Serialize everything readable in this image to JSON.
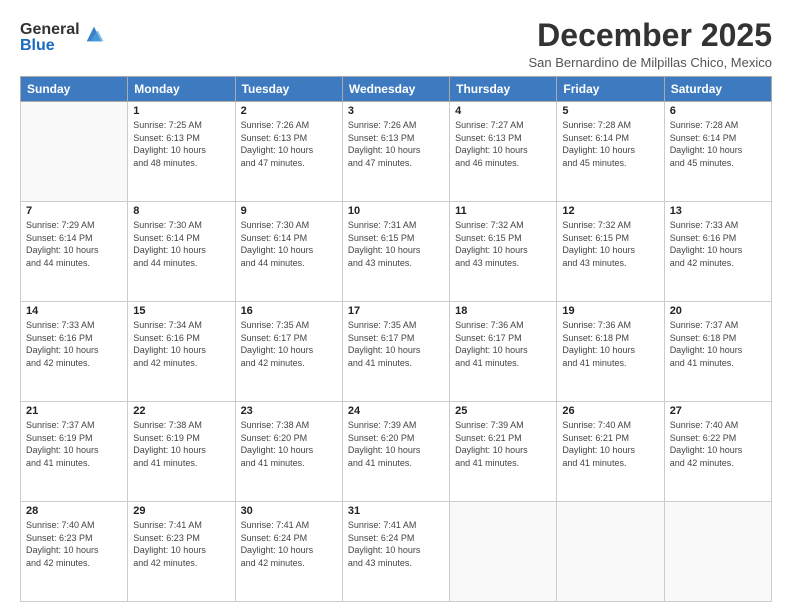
{
  "logo": {
    "general": "General",
    "blue": "Blue"
  },
  "title": "December 2025",
  "subtitle": "San Bernardino de Milpillas Chico, Mexico",
  "days_of_week": [
    "Sunday",
    "Monday",
    "Tuesday",
    "Wednesday",
    "Thursday",
    "Friday",
    "Saturday"
  ],
  "weeks": [
    [
      {
        "day": "",
        "info": ""
      },
      {
        "day": "1",
        "info": "Sunrise: 7:25 AM\nSunset: 6:13 PM\nDaylight: 10 hours\nand 48 minutes."
      },
      {
        "day": "2",
        "info": "Sunrise: 7:26 AM\nSunset: 6:13 PM\nDaylight: 10 hours\nand 47 minutes."
      },
      {
        "day": "3",
        "info": "Sunrise: 7:26 AM\nSunset: 6:13 PM\nDaylight: 10 hours\nand 47 minutes."
      },
      {
        "day": "4",
        "info": "Sunrise: 7:27 AM\nSunset: 6:13 PM\nDaylight: 10 hours\nand 46 minutes."
      },
      {
        "day": "5",
        "info": "Sunrise: 7:28 AM\nSunset: 6:14 PM\nDaylight: 10 hours\nand 45 minutes."
      },
      {
        "day": "6",
        "info": "Sunrise: 7:28 AM\nSunset: 6:14 PM\nDaylight: 10 hours\nand 45 minutes."
      }
    ],
    [
      {
        "day": "7",
        "info": "Sunrise: 7:29 AM\nSunset: 6:14 PM\nDaylight: 10 hours\nand 44 minutes."
      },
      {
        "day": "8",
        "info": "Sunrise: 7:30 AM\nSunset: 6:14 PM\nDaylight: 10 hours\nand 44 minutes."
      },
      {
        "day": "9",
        "info": "Sunrise: 7:30 AM\nSunset: 6:14 PM\nDaylight: 10 hours\nand 44 minutes."
      },
      {
        "day": "10",
        "info": "Sunrise: 7:31 AM\nSunset: 6:15 PM\nDaylight: 10 hours\nand 43 minutes."
      },
      {
        "day": "11",
        "info": "Sunrise: 7:32 AM\nSunset: 6:15 PM\nDaylight: 10 hours\nand 43 minutes."
      },
      {
        "day": "12",
        "info": "Sunrise: 7:32 AM\nSunset: 6:15 PM\nDaylight: 10 hours\nand 43 minutes."
      },
      {
        "day": "13",
        "info": "Sunrise: 7:33 AM\nSunset: 6:16 PM\nDaylight: 10 hours\nand 42 minutes."
      }
    ],
    [
      {
        "day": "14",
        "info": "Sunrise: 7:33 AM\nSunset: 6:16 PM\nDaylight: 10 hours\nand 42 minutes."
      },
      {
        "day": "15",
        "info": "Sunrise: 7:34 AM\nSunset: 6:16 PM\nDaylight: 10 hours\nand 42 minutes."
      },
      {
        "day": "16",
        "info": "Sunrise: 7:35 AM\nSunset: 6:17 PM\nDaylight: 10 hours\nand 42 minutes."
      },
      {
        "day": "17",
        "info": "Sunrise: 7:35 AM\nSunset: 6:17 PM\nDaylight: 10 hours\nand 41 minutes."
      },
      {
        "day": "18",
        "info": "Sunrise: 7:36 AM\nSunset: 6:17 PM\nDaylight: 10 hours\nand 41 minutes."
      },
      {
        "day": "19",
        "info": "Sunrise: 7:36 AM\nSunset: 6:18 PM\nDaylight: 10 hours\nand 41 minutes."
      },
      {
        "day": "20",
        "info": "Sunrise: 7:37 AM\nSunset: 6:18 PM\nDaylight: 10 hours\nand 41 minutes."
      }
    ],
    [
      {
        "day": "21",
        "info": "Sunrise: 7:37 AM\nSunset: 6:19 PM\nDaylight: 10 hours\nand 41 minutes."
      },
      {
        "day": "22",
        "info": "Sunrise: 7:38 AM\nSunset: 6:19 PM\nDaylight: 10 hours\nand 41 minutes."
      },
      {
        "day": "23",
        "info": "Sunrise: 7:38 AM\nSunset: 6:20 PM\nDaylight: 10 hours\nand 41 minutes."
      },
      {
        "day": "24",
        "info": "Sunrise: 7:39 AM\nSunset: 6:20 PM\nDaylight: 10 hours\nand 41 minutes."
      },
      {
        "day": "25",
        "info": "Sunrise: 7:39 AM\nSunset: 6:21 PM\nDaylight: 10 hours\nand 41 minutes."
      },
      {
        "day": "26",
        "info": "Sunrise: 7:40 AM\nSunset: 6:21 PM\nDaylight: 10 hours\nand 41 minutes."
      },
      {
        "day": "27",
        "info": "Sunrise: 7:40 AM\nSunset: 6:22 PM\nDaylight: 10 hours\nand 42 minutes."
      }
    ],
    [
      {
        "day": "28",
        "info": "Sunrise: 7:40 AM\nSunset: 6:23 PM\nDaylight: 10 hours\nand 42 minutes."
      },
      {
        "day": "29",
        "info": "Sunrise: 7:41 AM\nSunset: 6:23 PM\nDaylight: 10 hours\nand 42 minutes."
      },
      {
        "day": "30",
        "info": "Sunrise: 7:41 AM\nSunset: 6:24 PM\nDaylight: 10 hours\nand 42 minutes."
      },
      {
        "day": "31",
        "info": "Sunrise: 7:41 AM\nSunset: 6:24 PM\nDaylight: 10 hours\nand 43 minutes."
      },
      {
        "day": "",
        "info": ""
      },
      {
        "day": "",
        "info": ""
      },
      {
        "day": "",
        "info": ""
      }
    ]
  ]
}
